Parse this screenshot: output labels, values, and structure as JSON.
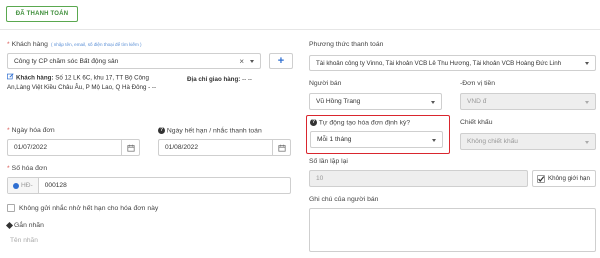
{
  "status_button": "ĐÃ THANH TOÁN",
  "customer": {
    "label": "Khách hàng",
    "hint": "( nhập tên, email, số điện thoại để tìm kiếm )",
    "value": "Công ty CP chăm sóc Bất động sản",
    "clear_symbol": "×",
    "add_symbol": "+",
    "address_label": "Khách hàng:",
    "address_value": "Số 12 LK 6C, khu 17, TT Bộ Công An,Làng Việt Kiều Châu Âu, P Mộ Lao, Q Hà Đông - --",
    "delivery_label": "Địa chỉ giao hàng:",
    "delivery_value": "-- --"
  },
  "payment_method": {
    "label": "Phương thức thanh toán",
    "value": "Tài khoản công ty Vinno, Tài khoản VCB Lê Thu Hương, Tài khoản VCB Hoàng Đức Linh"
  },
  "seller": {
    "label": "Người bán",
    "value": "Vũ Hồng Trang"
  },
  "currency": {
    "label": "Đơn vị tiền",
    "value": "VND đ"
  },
  "invoice_date": {
    "label": "Ngày hóa đơn",
    "value": "01/07/2022"
  },
  "due_date": {
    "label": "Ngày hết hạn / nhắc thanh toán",
    "value": "01/08/2022"
  },
  "auto_invoice": {
    "label": "Tự động tạo hóa đơn định kỳ?",
    "value": "Mỗi 1 tháng"
  },
  "discount": {
    "label": "Chiết khấu",
    "placeholder": "Không chiết khấu"
  },
  "repeat_count": {
    "label": "Số lần lặp lại",
    "value": "10",
    "unlimited_label": "Không giới hạn"
  },
  "invoice_number": {
    "label": "Số hóa đơn",
    "prefix": "HĐ-",
    "value": "000128"
  },
  "no_reminder_label": "Không gửi nhắc nhở hết hạn cho hóa đơn này",
  "tags": {
    "label": "Gắn nhãn",
    "placeholder": "Tên nhãn"
  },
  "seller_note": {
    "label": "Ghi chú của người bán"
  }
}
